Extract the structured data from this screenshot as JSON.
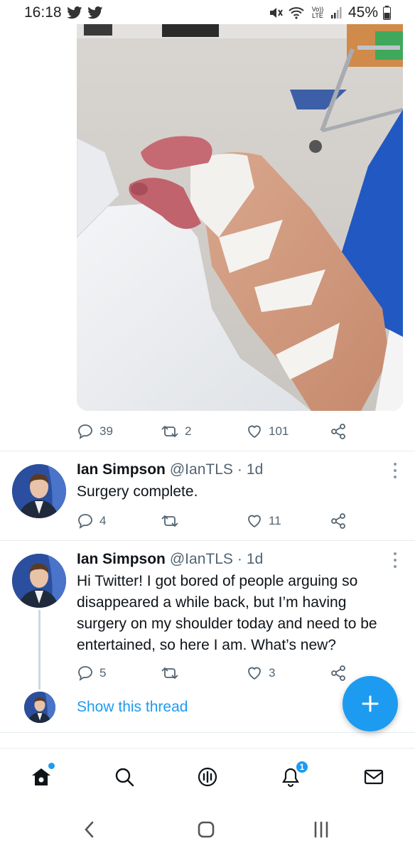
{
  "status_bar": {
    "time": "16:18",
    "notifications": [
      "twitter-icon",
      "twitter-icon"
    ],
    "network_label": "Vo)) LTE",
    "battery": "45%"
  },
  "top_tweet_actions": {
    "replies": "39",
    "retweets": "2",
    "likes": "101"
  },
  "tweets": [
    {
      "author": "Ian Simpson",
      "handle": "@IanTLS",
      "separator": "·",
      "time": "1d",
      "text": "Surgery complete.",
      "replies": "4",
      "retweets": "",
      "likes": "11"
    },
    {
      "author": "Ian Simpson",
      "handle": "@IanTLS",
      "separator": "·",
      "time": "1d",
      "text": "Hi Twitter! I got bored of people arguing so disappeared a while back, but I’m having surgery on my shoulder today and need to be entertained, so here I am. What’s new?",
      "replies": "5",
      "retweets": "",
      "likes": "3"
    }
  ],
  "thread": {
    "show_label": "Show this thread"
  },
  "bottom_nav": {
    "items": [
      "home-icon",
      "search-icon",
      "spaces-icon",
      "notifications-icon",
      "messages-icon"
    ],
    "notification_count": "1"
  },
  "colors": {
    "accent": "#1d9bf0",
    "text_primary": "#0f1419",
    "text_secondary": "#536471",
    "divider": "#e6ecf0"
  }
}
